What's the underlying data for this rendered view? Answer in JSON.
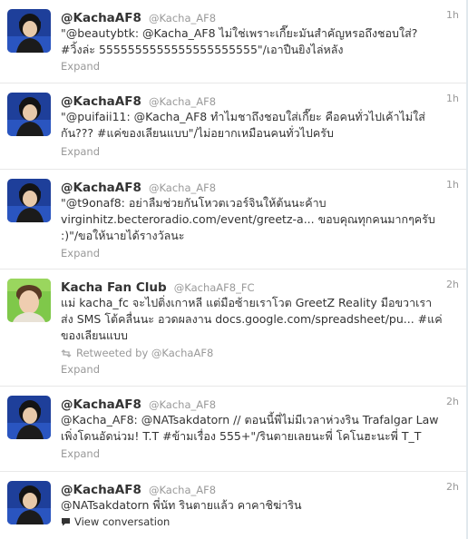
{
  "tweets": [
    {
      "name": "@KachaAF8",
      "handle": "@Kacha_AF8",
      "time": "1h",
      "lines": [
        "\"@beautybtk: @Kacha_AF8 ไม่ใช่เพราะเกี๊ยะมันสำคัญหรอถึงชอบใส่?",
        "#วิ้งล่ะ 5555555555555555555555\"/เอาปืนยิงไล่หลัง"
      ],
      "expand": "Expand"
    },
    {
      "name": "@KachaAF8",
      "handle": "@Kacha_AF8",
      "time": "1h",
      "lines": [
        "\"@puifaii11: @Kacha_AF8 ทำไมชาถึงชอบใส่เกี๊ยะ คือคนทั่วไปเค้าไม่ใส่",
        "กัน??? #แค่ของเลียนแบบ\"/ไม่อยากเหมือนคนทั่วไปครับ"
      ],
      "expand": "Expand"
    },
    {
      "name": "@KachaAF8",
      "handle": "@Kacha_AF8",
      "time": "1h",
      "lines": [
        "\"@t9onaf8: อย่าลืมช่วยกันโหวตเวอร์จินให้ต้นนะค้าบ",
        "virginhitz.becteroradio.com/event/greetz-a... ขอบคุณทุกคนมากๆครับ",
        ":)\"/ขอให้นายได้รางวัลนะ"
      ],
      "expand": "Expand"
    },
    {
      "name": "Kacha Fan Club",
      "handle": "@KachaAF8_FC",
      "time": "2h",
      "lines": [
        "แม่ kacha_fc จะไปติ่งเกาหลี แต่มือซ้ายเราโวต GreetZ Reality มือขวาเรา",
        "ส่ง SMS โต้คลื่นนะ อวดผลงาน docs.google.com/spreadsheet/pu... #แค่",
        "ของเลียนแบบ"
      ],
      "retweeted_by": "Retweeted by @KachaAF8",
      "expand": "Expand"
    },
    {
      "name": "@KachaAF8",
      "handle": "@Kacha_AF8",
      "time": "2h",
      "lines": [
        "@Kacha_AF8: @NATsakdatorn // ตอนนี้พี่ไม่มีเวลาห่วงริน Trafalgar Law",
        "เพิ่งโดนอัดน่วม! T.T #ข้ามเรื่อง 555+\"/รินตายเลยนะพี่ โคโนฮะนะพี่ T_T"
      ],
      "expand": "Expand"
    },
    {
      "name": "@KachaAF8",
      "handle": "@Kacha_AF8",
      "time": "2h",
      "lines": [
        "@NATsakdatorn พี่นัท รินตายแล้ว คาคาชิฆ่าริน"
      ],
      "view_conversation": "View conversation"
    }
  ]
}
